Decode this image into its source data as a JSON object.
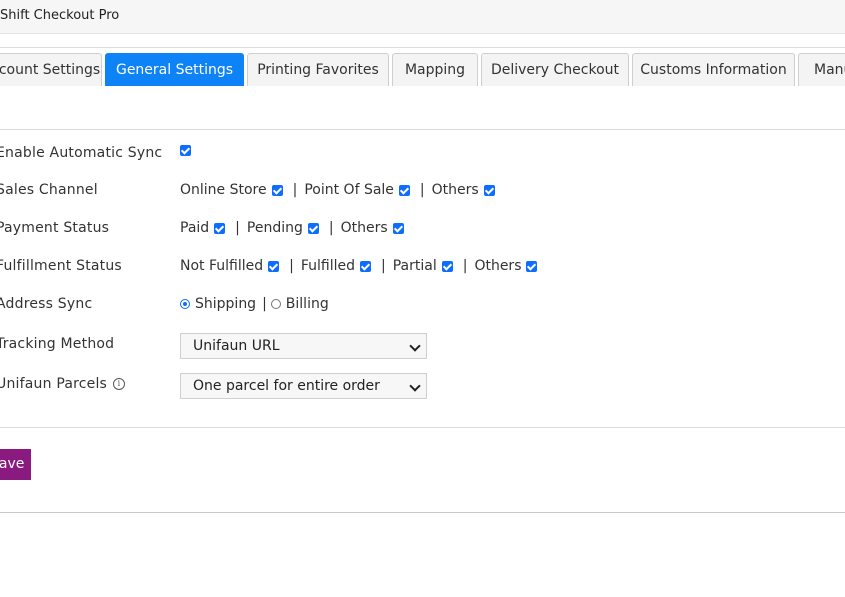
{
  "app": {
    "title": "Shift Checkout Pro"
  },
  "tabs": [
    {
      "label": "Account Settings"
    },
    {
      "label": "General Settings"
    },
    {
      "label": "Printing Favorites"
    },
    {
      "label": "Mapping"
    },
    {
      "label": "Delivery Checkout"
    },
    {
      "label": "Customs Information"
    },
    {
      "label": "Manual"
    }
  ],
  "active_tab": "General Settings",
  "settings": {
    "auto_sync": {
      "label": "Enable Automatic Sync",
      "checked": true
    },
    "sales_channel": {
      "label": "Sales Channel",
      "options": [
        {
          "label": "Online Store",
          "checked": true
        },
        {
          "label": "Point Of Sale",
          "checked": true
        },
        {
          "label": "Others",
          "checked": true
        }
      ]
    },
    "payment_status": {
      "label": "Payment Status",
      "options": [
        {
          "label": "Paid",
          "checked": true
        },
        {
          "label": "Pending",
          "checked": true
        },
        {
          "label": "Others",
          "checked": true
        }
      ]
    },
    "fulfillment_status": {
      "label": "Fulfillment Status",
      "options": [
        {
          "label": "Not Fulfilled",
          "checked": true
        },
        {
          "label": "Fulfilled",
          "checked": true
        },
        {
          "label": "Partial",
          "checked": true
        },
        {
          "label": "Others",
          "checked": true
        }
      ]
    },
    "address_sync": {
      "label": "Address Sync",
      "options": [
        {
          "label": "Shipping",
          "selected": true
        },
        {
          "label": "Billing",
          "selected": false
        }
      ]
    },
    "tracking_method": {
      "label": "Tracking Method",
      "value": "Unifaun URL"
    },
    "unifaun_parcels": {
      "label": "Unifaun Parcels",
      "value": "One parcel for entire order",
      "info_icon": "info-icon"
    }
  },
  "separator": "|",
  "actions": {
    "save_label": "Save"
  }
}
